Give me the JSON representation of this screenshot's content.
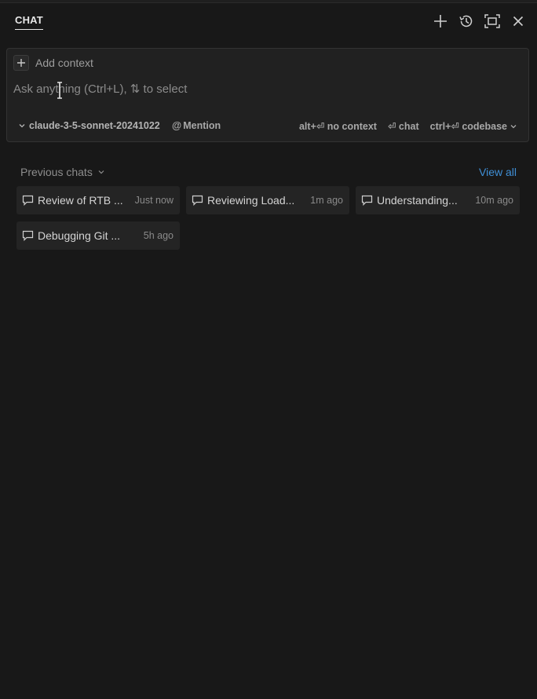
{
  "header": {
    "tab_label": "CHAT",
    "actions": [
      "new-chat",
      "history",
      "maximize",
      "close"
    ]
  },
  "composer": {
    "add_context_label": "Add context",
    "placeholder": "Ask anything (Ctrl+L), ⇅ to select",
    "value": "",
    "model": "claude-3-5-sonnet-20241022",
    "mention_label": "Mention",
    "shortcut_no_context": "alt+⏎ no context",
    "shortcut_chat": "⏎ chat",
    "shortcut_codebase": "ctrl+⏎ codebase"
  },
  "previous_chats": {
    "title": "Previous chats",
    "view_all_label": "View all",
    "items": [
      {
        "title": "Review of RTB ...",
        "time": "Just now"
      },
      {
        "title": "Reviewing Load...",
        "time": "1m ago"
      },
      {
        "title": "Understanding...",
        "time": "10m ago"
      },
      {
        "title": "Debugging Git ...",
        "time": "5h ago"
      }
    ]
  },
  "colors": {
    "background": "#181818",
    "composer_bg": "#212121",
    "card_bg": "#242424",
    "link": "#3f8fd6"
  }
}
